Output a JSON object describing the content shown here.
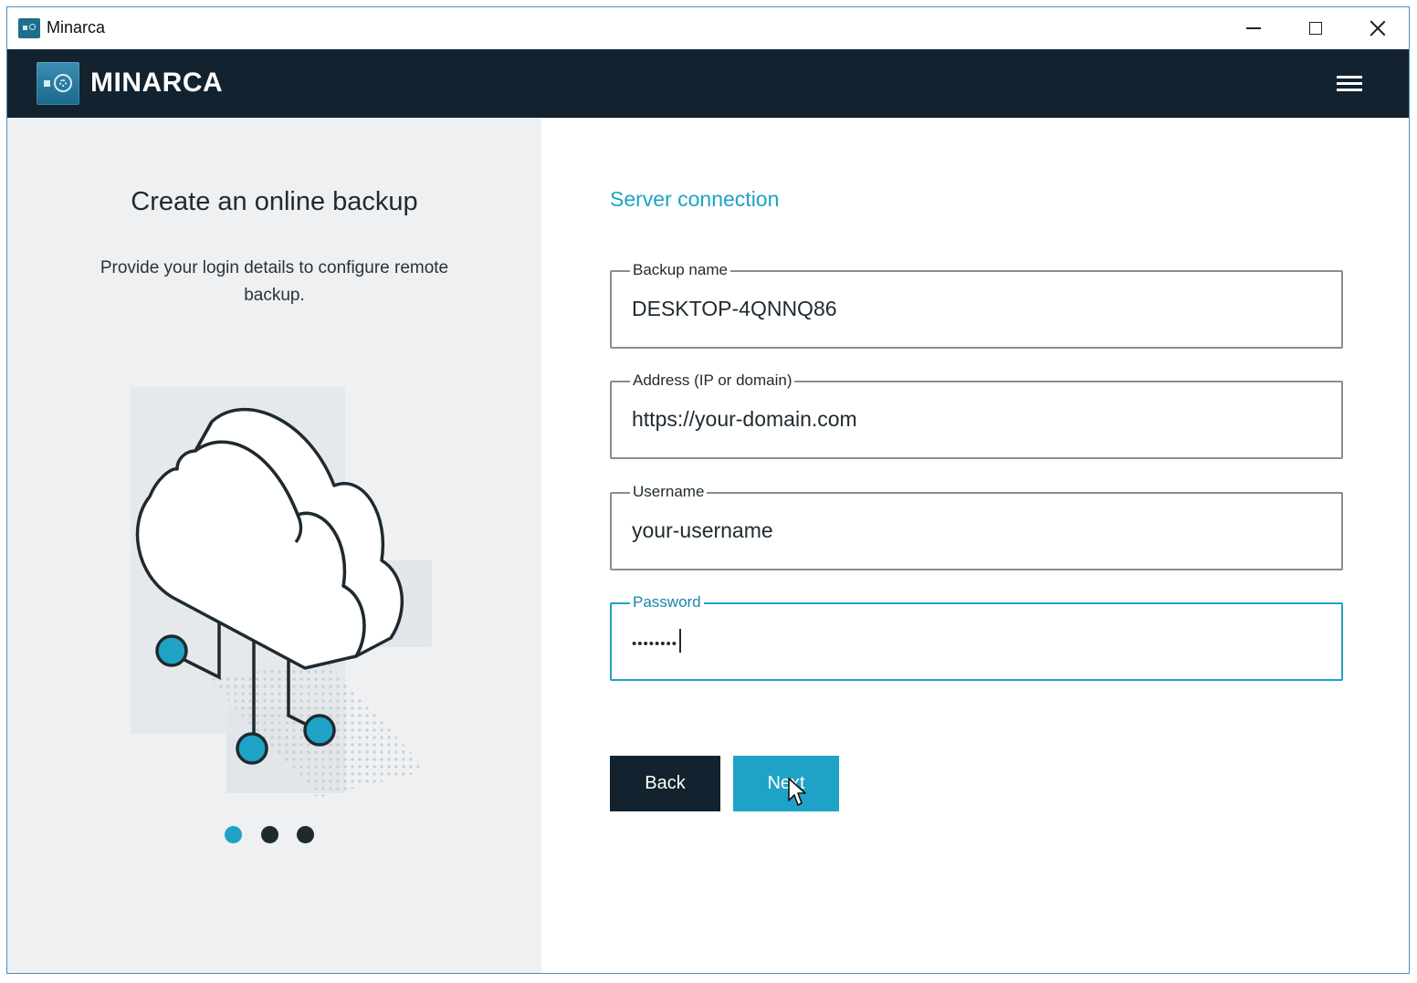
{
  "window": {
    "title": "Minarca",
    "controls": [
      "minimize",
      "maximize",
      "close"
    ]
  },
  "header": {
    "brand": "MINARCA",
    "menu_icon": "hamburger-menu-icon"
  },
  "left_panel": {
    "heading": "Create an online backup",
    "description": "Provide your login details to configure remote backup.",
    "illustration": "cloud-network-illustration",
    "pager": {
      "total": 3,
      "active": 1
    }
  },
  "form": {
    "section_title": "Server connection",
    "fields": [
      {
        "label": "Backup name",
        "value": "DESKTOP-4QNNQ86"
      },
      {
        "label": "Address (IP or domain)",
        "value": "https://your-domain.com"
      },
      {
        "label": "Username",
        "value": "your-username"
      },
      {
        "label": "Password",
        "value": "••••••••",
        "focused": true
      }
    ],
    "back_label": "Back",
    "next_label": "Next"
  },
  "colors": {
    "header_bg": "#12232f",
    "accent": "#1ea3c6",
    "left_panel_bg": "#eef0f2",
    "back_button_bg": "#12232f"
  }
}
